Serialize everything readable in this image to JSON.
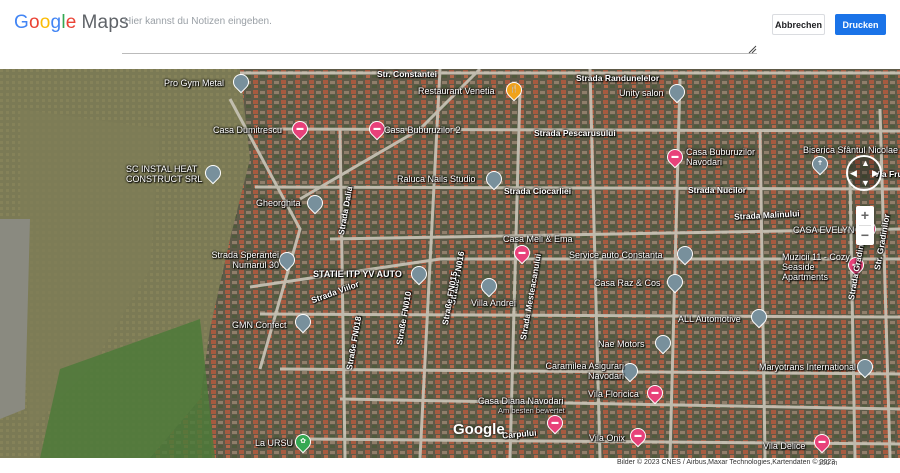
{
  "header": {
    "logo_google": "Google",
    "logo_maps": "Maps",
    "notes_placeholder": "Hier kannst du Notizen eingeben.",
    "cancel_label": "Abbrechen",
    "print_label": "Drucken",
    "accent_color": "#1a73e8"
  },
  "map": {
    "type": "satellite",
    "places": [
      {
        "name": "Pro Gym Metal",
        "icon": "pin-gray"
      },
      {
        "name": "Restaurant Venetia",
        "icon": "pin-orange-restaurant"
      },
      {
        "name": "Unity salon",
        "icon": "pin-gray"
      },
      {
        "name": "Casa Dumitrescu",
        "icon": "pin-pink-hotel"
      },
      {
        "name": "Casa Buburuzilor 2",
        "icon": "pin-pink-hotel"
      },
      {
        "name": "Casa Buburuzilor Navodari",
        "icon": "pin-pink-hotel"
      },
      {
        "name": "Biserica Sfântul Nicolae",
        "icon": "pin-gray-church"
      },
      {
        "name": "SC INSTAL HEAT CONSTRUCT SRL",
        "icon": "pin-gray"
      },
      {
        "name": "Raluca Nails Studio",
        "icon": "pin-gray"
      },
      {
        "name": "Gheorghita",
        "icon": "pin-gray"
      },
      {
        "name": "CASA EVELYN",
        "icon": "pin-pink-hotel"
      },
      {
        "name": "Casa Meli & Ema",
        "icon": "pin-pink-hotel"
      },
      {
        "name": "Service auto Constanta",
        "icon": "pin-gray"
      },
      {
        "name": "Strada Sperantei Numarul 30",
        "icon": "pin-gray"
      },
      {
        "name": "STATIE ITP YV AUTO",
        "icon": "pin-gray"
      },
      {
        "name": "Muzicii 11 - Cozy Seaside Apartments",
        "icon": "pin-pink-hotel"
      },
      {
        "name": "Casa Raz & Cos",
        "icon": "pin-gray"
      },
      {
        "name": "Villa Andrei",
        "icon": "pin-gray"
      },
      {
        "name": "GMN Confect",
        "icon": "pin-gray"
      },
      {
        "name": "ALL Automotive",
        "icon": "pin-gray"
      },
      {
        "name": "Nae Motors",
        "icon": "pin-gray"
      },
      {
        "name": "Caramilea Asigurari Navodari",
        "icon": "pin-gray"
      },
      {
        "name": "Maryotrans International",
        "icon": "pin-gray"
      },
      {
        "name": "Vila Floricica",
        "icon": "pin-pink-hotel"
      },
      {
        "name": "Casa Diana Navodari",
        "icon": "pin-pink-hotel"
      },
      {
        "name": "Am besten bewertet",
        "icon": ""
      },
      {
        "name": "Vila Onix",
        "icon": "pin-pink-hotel"
      },
      {
        "name": "Vila Delice",
        "icon": "pin-pink-hotel"
      },
      {
        "name": "La URSU",
        "icon": "pin-green"
      }
    ],
    "streets": [
      "Str. Constantei",
      "Strada Randunelelor",
      "Strada Pescarusului",
      "Strada Ciocarliei",
      "Strada Nucilor",
      "Strada Malinului",
      "Strada Gradinilor",
      "Str. Gradinilor",
      "Strada Mesteacanului",
      "Strada Viilor",
      "Strada Dalia",
      "Straße FN016",
      "Straße FN015",
      "Straße FN018",
      "Straße FN010",
      "Carpului",
      "Via Fru"
    ],
    "watermark": "Google"
  },
  "footer": {
    "attribution": "Bilder © 2023 CNES / Airbus,Maxar Technologies,Kartendaten © 2023",
    "scale": "100 m"
  }
}
